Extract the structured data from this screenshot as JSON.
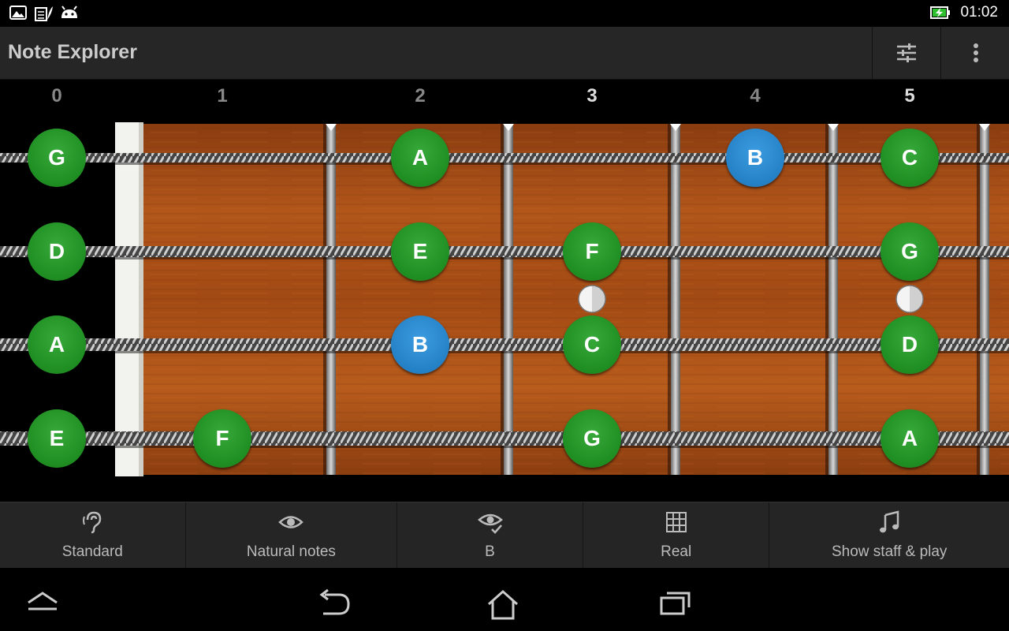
{
  "status_bar": {
    "time": "01:02",
    "icons": [
      "image-icon",
      "sim-card-icon",
      "android-icon",
      "battery-charging-icon"
    ]
  },
  "action_bar": {
    "title": "Note Explorer",
    "actions": [
      "settings-sliders-icon",
      "overflow-menu-icon"
    ]
  },
  "fretboard": {
    "fret_numbers": [
      "0",
      "1",
      "2",
      "3",
      "4",
      "5"
    ],
    "strings": [
      {
        "name": "G",
        "notes": [
          {
            "fret": 0,
            "label": "G",
            "kind": "natural"
          },
          {
            "fret": 2,
            "label": "A",
            "kind": "natural"
          },
          {
            "fret": 4,
            "label": "B",
            "kind": "highlight"
          },
          {
            "fret": 5,
            "label": "C",
            "kind": "natural"
          }
        ]
      },
      {
        "name": "D",
        "notes": [
          {
            "fret": 0,
            "label": "D",
            "kind": "natural"
          },
          {
            "fret": 2,
            "label": "E",
            "kind": "natural"
          },
          {
            "fret": 3,
            "label": "F",
            "kind": "natural"
          },
          {
            "fret": 5,
            "label": "G",
            "kind": "natural"
          }
        ]
      },
      {
        "name": "A",
        "notes": [
          {
            "fret": 0,
            "label": "A",
            "kind": "natural"
          },
          {
            "fret": 2,
            "label": "B",
            "kind": "highlight"
          },
          {
            "fret": 3,
            "label": "C",
            "kind": "natural"
          },
          {
            "fret": 5,
            "label": "D",
            "kind": "natural"
          }
        ]
      },
      {
        "name": "E",
        "notes": [
          {
            "fret": 0,
            "label": "E",
            "kind": "natural"
          },
          {
            "fret": 1,
            "label": "F",
            "kind": "natural"
          },
          {
            "fret": 3,
            "label": "G",
            "kind": "natural"
          },
          {
            "fret": 5,
            "label": "A",
            "kind": "natural"
          }
        ]
      }
    ],
    "inlay_frets": [
      3,
      5
    ],
    "colors": {
      "natural": "#1f8e22",
      "highlight": "#2581c6",
      "wood": "#a04a14",
      "fret": "#9a9a9a",
      "nut": "#f2f2ee"
    }
  },
  "toolbar": {
    "buttons": [
      {
        "label": "Standard",
        "icon": "ear-icon"
      },
      {
        "label": "Natural notes",
        "icon": "eye-icon"
      },
      {
        "label": "B",
        "icon": "eye-check-icon"
      },
      {
        "label": "Real",
        "icon": "grid-icon"
      },
      {
        "label": "Show staff & play",
        "icon": "music-note-icon"
      }
    ]
  },
  "nav_bar": {
    "buttons": [
      "menu-up-icon",
      "back-icon",
      "home-icon",
      "recent-apps-icon"
    ]
  }
}
